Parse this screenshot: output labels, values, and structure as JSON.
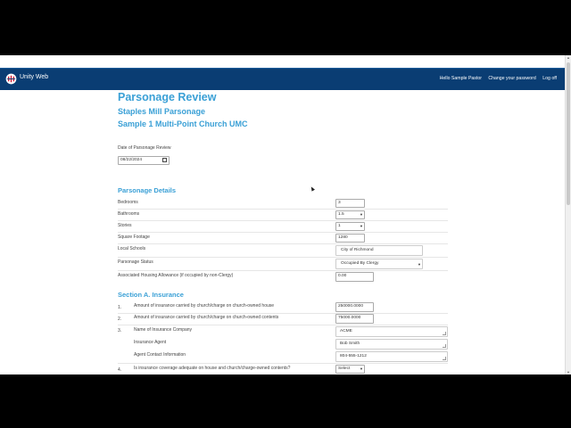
{
  "app": {
    "brand": "Unity Web",
    "nav": {
      "greeting": "Hello Sample Pastor",
      "change_password": "Change your password",
      "logout": "Log off"
    }
  },
  "page": {
    "title": "Parsonage Review",
    "parsonage": "Staples Mill Parsonage",
    "church": "Sample 1 Multi-Point Church UMC",
    "date_label": "Date of Parsonage Review",
    "date_value": "08/22/2024"
  },
  "details": {
    "heading": "Parsonage Details",
    "bedrooms_label": "Bedrooms",
    "bedrooms_value": "3",
    "bathrooms_label": "Bathrooms",
    "bathrooms_value": "1.5",
    "stories_label": "Stories",
    "stories_value": "1",
    "sqft_label": "Square Footage",
    "sqft_value": "1280",
    "schools_label": "Local Schools",
    "schools_value": "City of Richmond",
    "status_label": "Parsonage Status",
    "status_value": "Occupied By Clergy",
    "housing_label": "Associated Housing Allowance (if occupied by non-Clergy)",
    "housing_value": "0.00"
  },
  "insurance": {
    "heading": "Section A. Insurance",
    "q1_num": "1.",
    "q1_label": "Amount of insurance carried by church/charge on church-owned house",
    "q1_value": "250000.0000",
    "q2_num": "2.",
    "q2_label": "Amount of insurance carried by church/charge on church-owned contents",
    "q2_value": "75000.0000",
    "q3_num": "3.",
    "company_label": "Name of Insurance Company",
    "company_value": "ACME",
    "agent_label": "Insurance Agent",
    "agent_value": "Bob Smith",
    "contact_label": "Agent Contact Information",
    "contact_value": "804-555-1212",
    "q4_num": "4.",
    "q4_label": "Is insurance coverage adequate on house and church/charge-owned contents?",
    "q4_value": "Select"
  }
}
